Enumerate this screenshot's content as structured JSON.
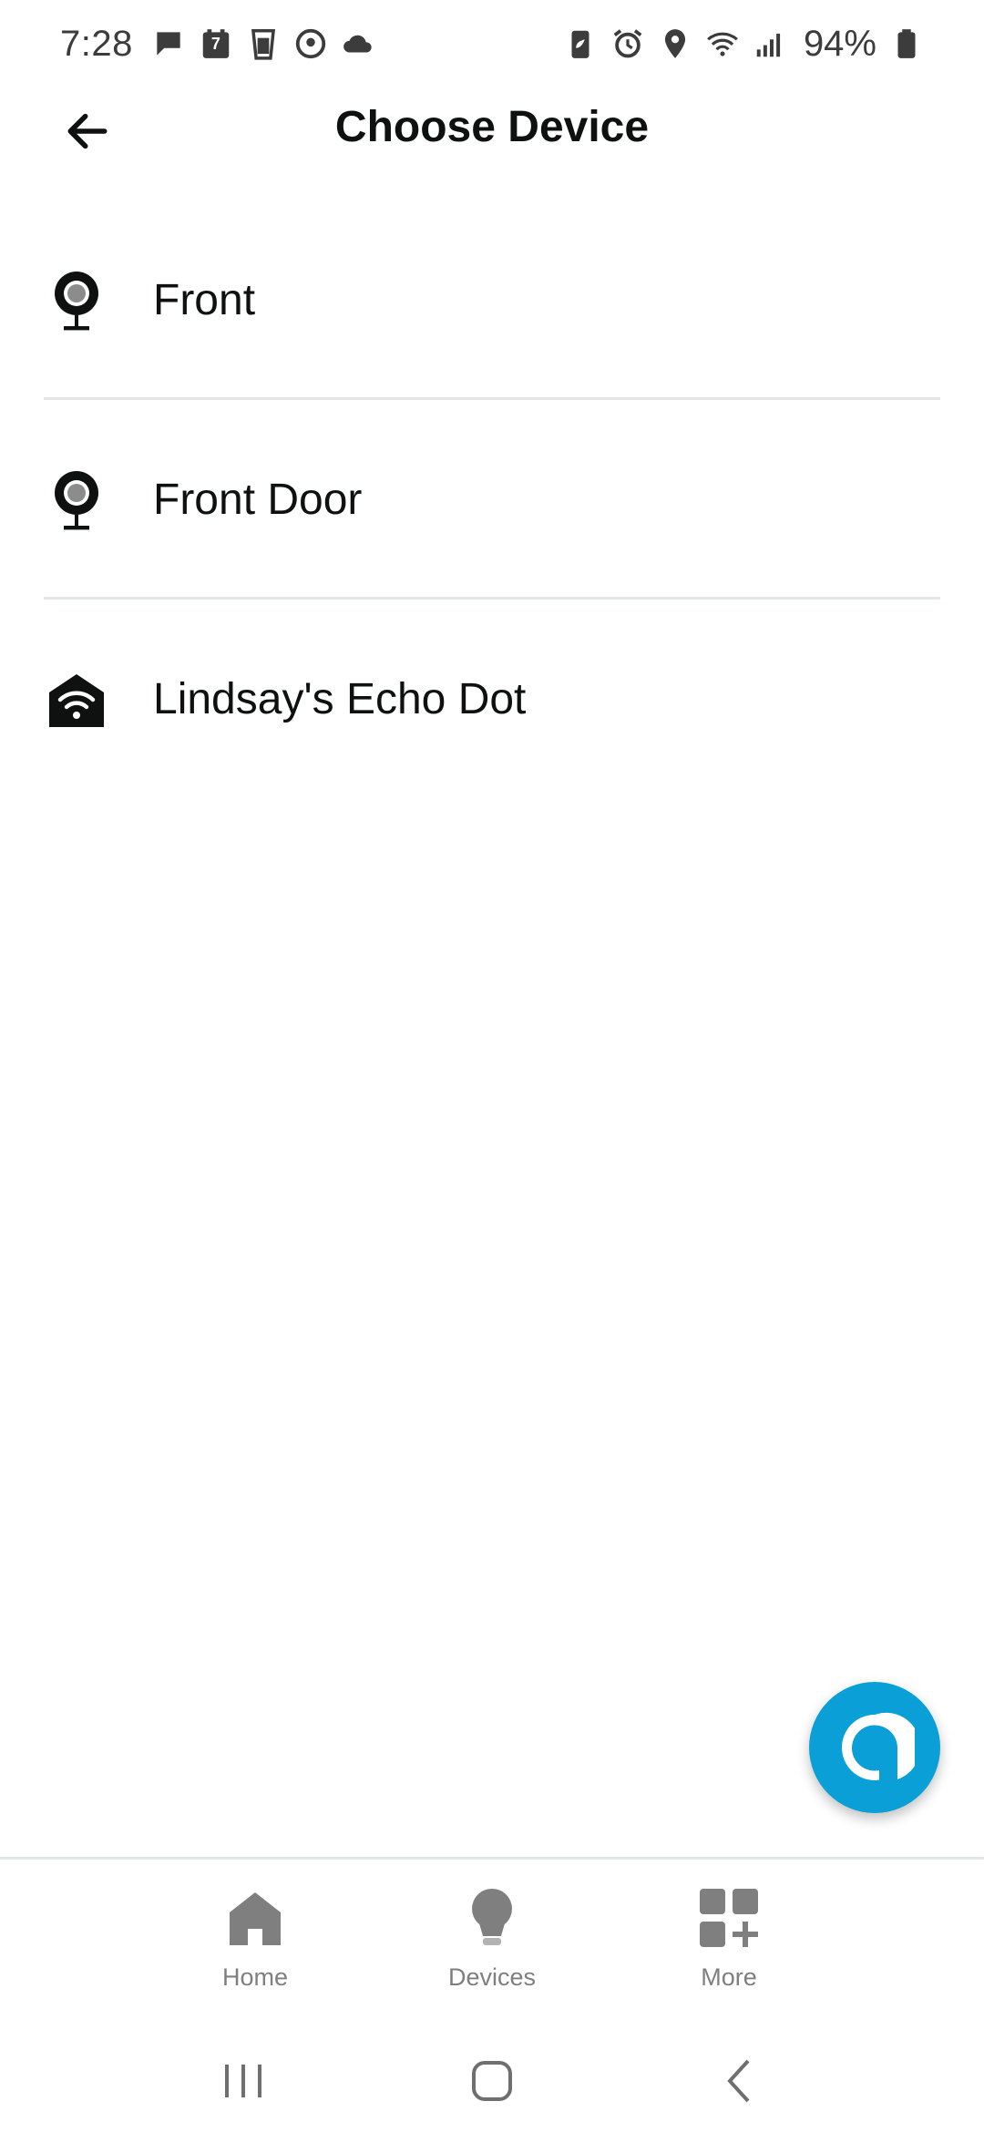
{
  "status_bar": {
    "time": "7:28",
    "battery": "94%",
    "left_icons": [
      "chat-bubble-icon",
      "calendar-icon",
      "cup-icon",
      "podcast-icon",
      "cloud-icon"
    ],
    "calendar_day": "7",
    "right_icons": [
      "battery-saver-icon",
      "alarm-icon",
      "location-icon",
      "wifi-icon",
      "signal-icon",
      "battery-icon"
    ]
  },
  "header": {
    "title": "Choose Device",
    "back_icon": "arrow-left-icon"
  },
  "devices": [
    {
      "label": "Front",
      "icon": "camera-icon"
    },
    {
      "label": "Front Door",
      "icon": "camera-icon"
    },
    {
      "label": "Lindsay's Echo Dot",
      "icon": "echo-house-icon"
    }
  ],
  "fab": {
    "icon": "alexa-icon"
  },
  "bottom_nav": [
    {
      "label": "Home",
      "icon": "home-icon"
    },
    {
      "label": "Devices",
      "icon": "bulb-icon"
    },
    {
      "label": "More",
      "icon": "grid-plus-icon"
    }
  ],
  "system_nav": [
    "recents-icon",
    "home-outline-icon",
    "back-chevron-icon"
  ],
  "colors": {
    "accent": "#0aa0d7",
    "text": "#0f1111",
    "muted": "#7f7f7f",
    "divider": "#e3e6e6"
  }
}
